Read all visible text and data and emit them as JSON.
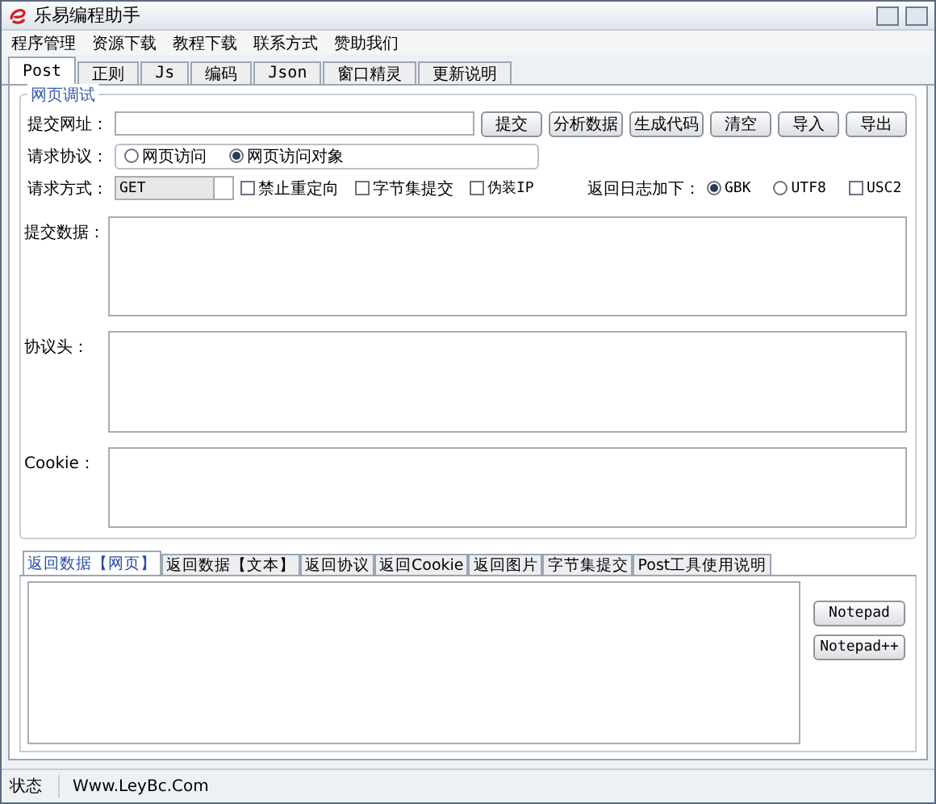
{
  "window": {
    "title": "乐易编程助手"
  },
  "menu": [
    "程序管理",
    "资源下载",
    "教程下载",
    "联系方式",
    "赞助我们"
  ],
  "tabs": [
    {
      "label": "Post",
      "selected": true
    },
    {
      "label": "正则",
      "selected": false
    },
    {
      "label": "Js",
      "selected": false
    },
    {
      "label": "编码",
      "selected": false
    },
    {
      "label": "Json",
      "selected": false
    },
    {
      "label": "窗口精灵",
      "selected": false
    },
    {
      "label": "更新说明",
      "selected": false
    }
  ],
  "group": {
    "title": "网页调试"
  },
  "url": {
    "label": "提交网址："
  },
  "buttons": [
    "提交",
    "分析数据",
    "生成代码",
    "清空",
    "导入",
    "导出"
  ],
  "protocol": {
    "label": "请求协议：",
    "options": [
      {
        "label": "网页访问",
        "selected": false
      },
      {
        "label": "网页访问对象",
        "selected": true
      }
    ]
  },
  "method": {
    "label": "请求方式：",
    "value": "GET"
  },
  "options": [
    {
      "label": "禁止重定向",
      "checked": false
    },
    {
      "label": "字节集提交",
      "checked": false
    },
    {
      "label": "伪装IP",
      "checked": false
    }
  ],
  "encoding": {
    "label": "返回日志加下：",
    "options": [
      {
        "kind": "radio",
        "label": "GBK",
        "selected": true
      },
      {
        "kind": "radio",
        "label": "UTF8",
        "selected": false
      },
      {
        "kind": "checkbox",
        "label": "USC2",
        "checked": false
      }
    ]
  },
  "text_areas": [
    {
      "label": "提交数据："
    },
    {
      "label": "协议头："
    },
    {
      "label": "Cookie："
    }
  ],
  "result_tabs": [
    {
      "label": "返回数据【网页】",
      "selected": true
    },
    {
      "label": "返回数据【文本】",
      "selected": false
    },
    {
      "label": "返回协议",
      "selected": false
    },
    {
      "label": "返回Cookie",
      "selected": false
    },
    {
      "label": "返回图片",
      "selected": false
    },
    {
      "label": "字节集提交",
      "selected": false
    },
    {
      "label": "Post工具使用说明",
      "selected": false
    }
  ],
  "side_buttons": [
    "Notepad",
    "Notepad++"
  ],
  "status_bar": {
    "label": "状态",
    "text": "Www.LeyBc.Com"
  }
}
